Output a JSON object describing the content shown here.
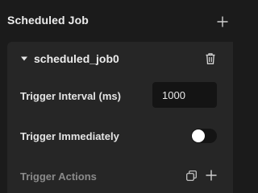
{
  "section": {
    "title": "Scheduled Job"
  },
  "job": {
    "name": "scheduled_job0",
    "expanded": true
  },
  "fields": {
    "trigger_interval": {
      "label": "Trigger Interval (ms)",
      "value": "1000"
    },
    "trigger_immediately": {
      "label": "Trigger Immediately",
      "enabled": false
    },
    "trigger_actions": {
      "label": "Trigger Actions"
    }
  },
  "icons": {
    "header_add": "plus-icon",
    "caret": "caret-down-icon",
    "delete": "trash-icon",
    "copy": "copy-icon",
    "actions_add": "plus-icon"
  },
  "colors": {
    "background": "#1b1b1b",
    "card": "#262626",
    "input": "#141414",
    "muted_text": "#8a8a8a"
  }
}
